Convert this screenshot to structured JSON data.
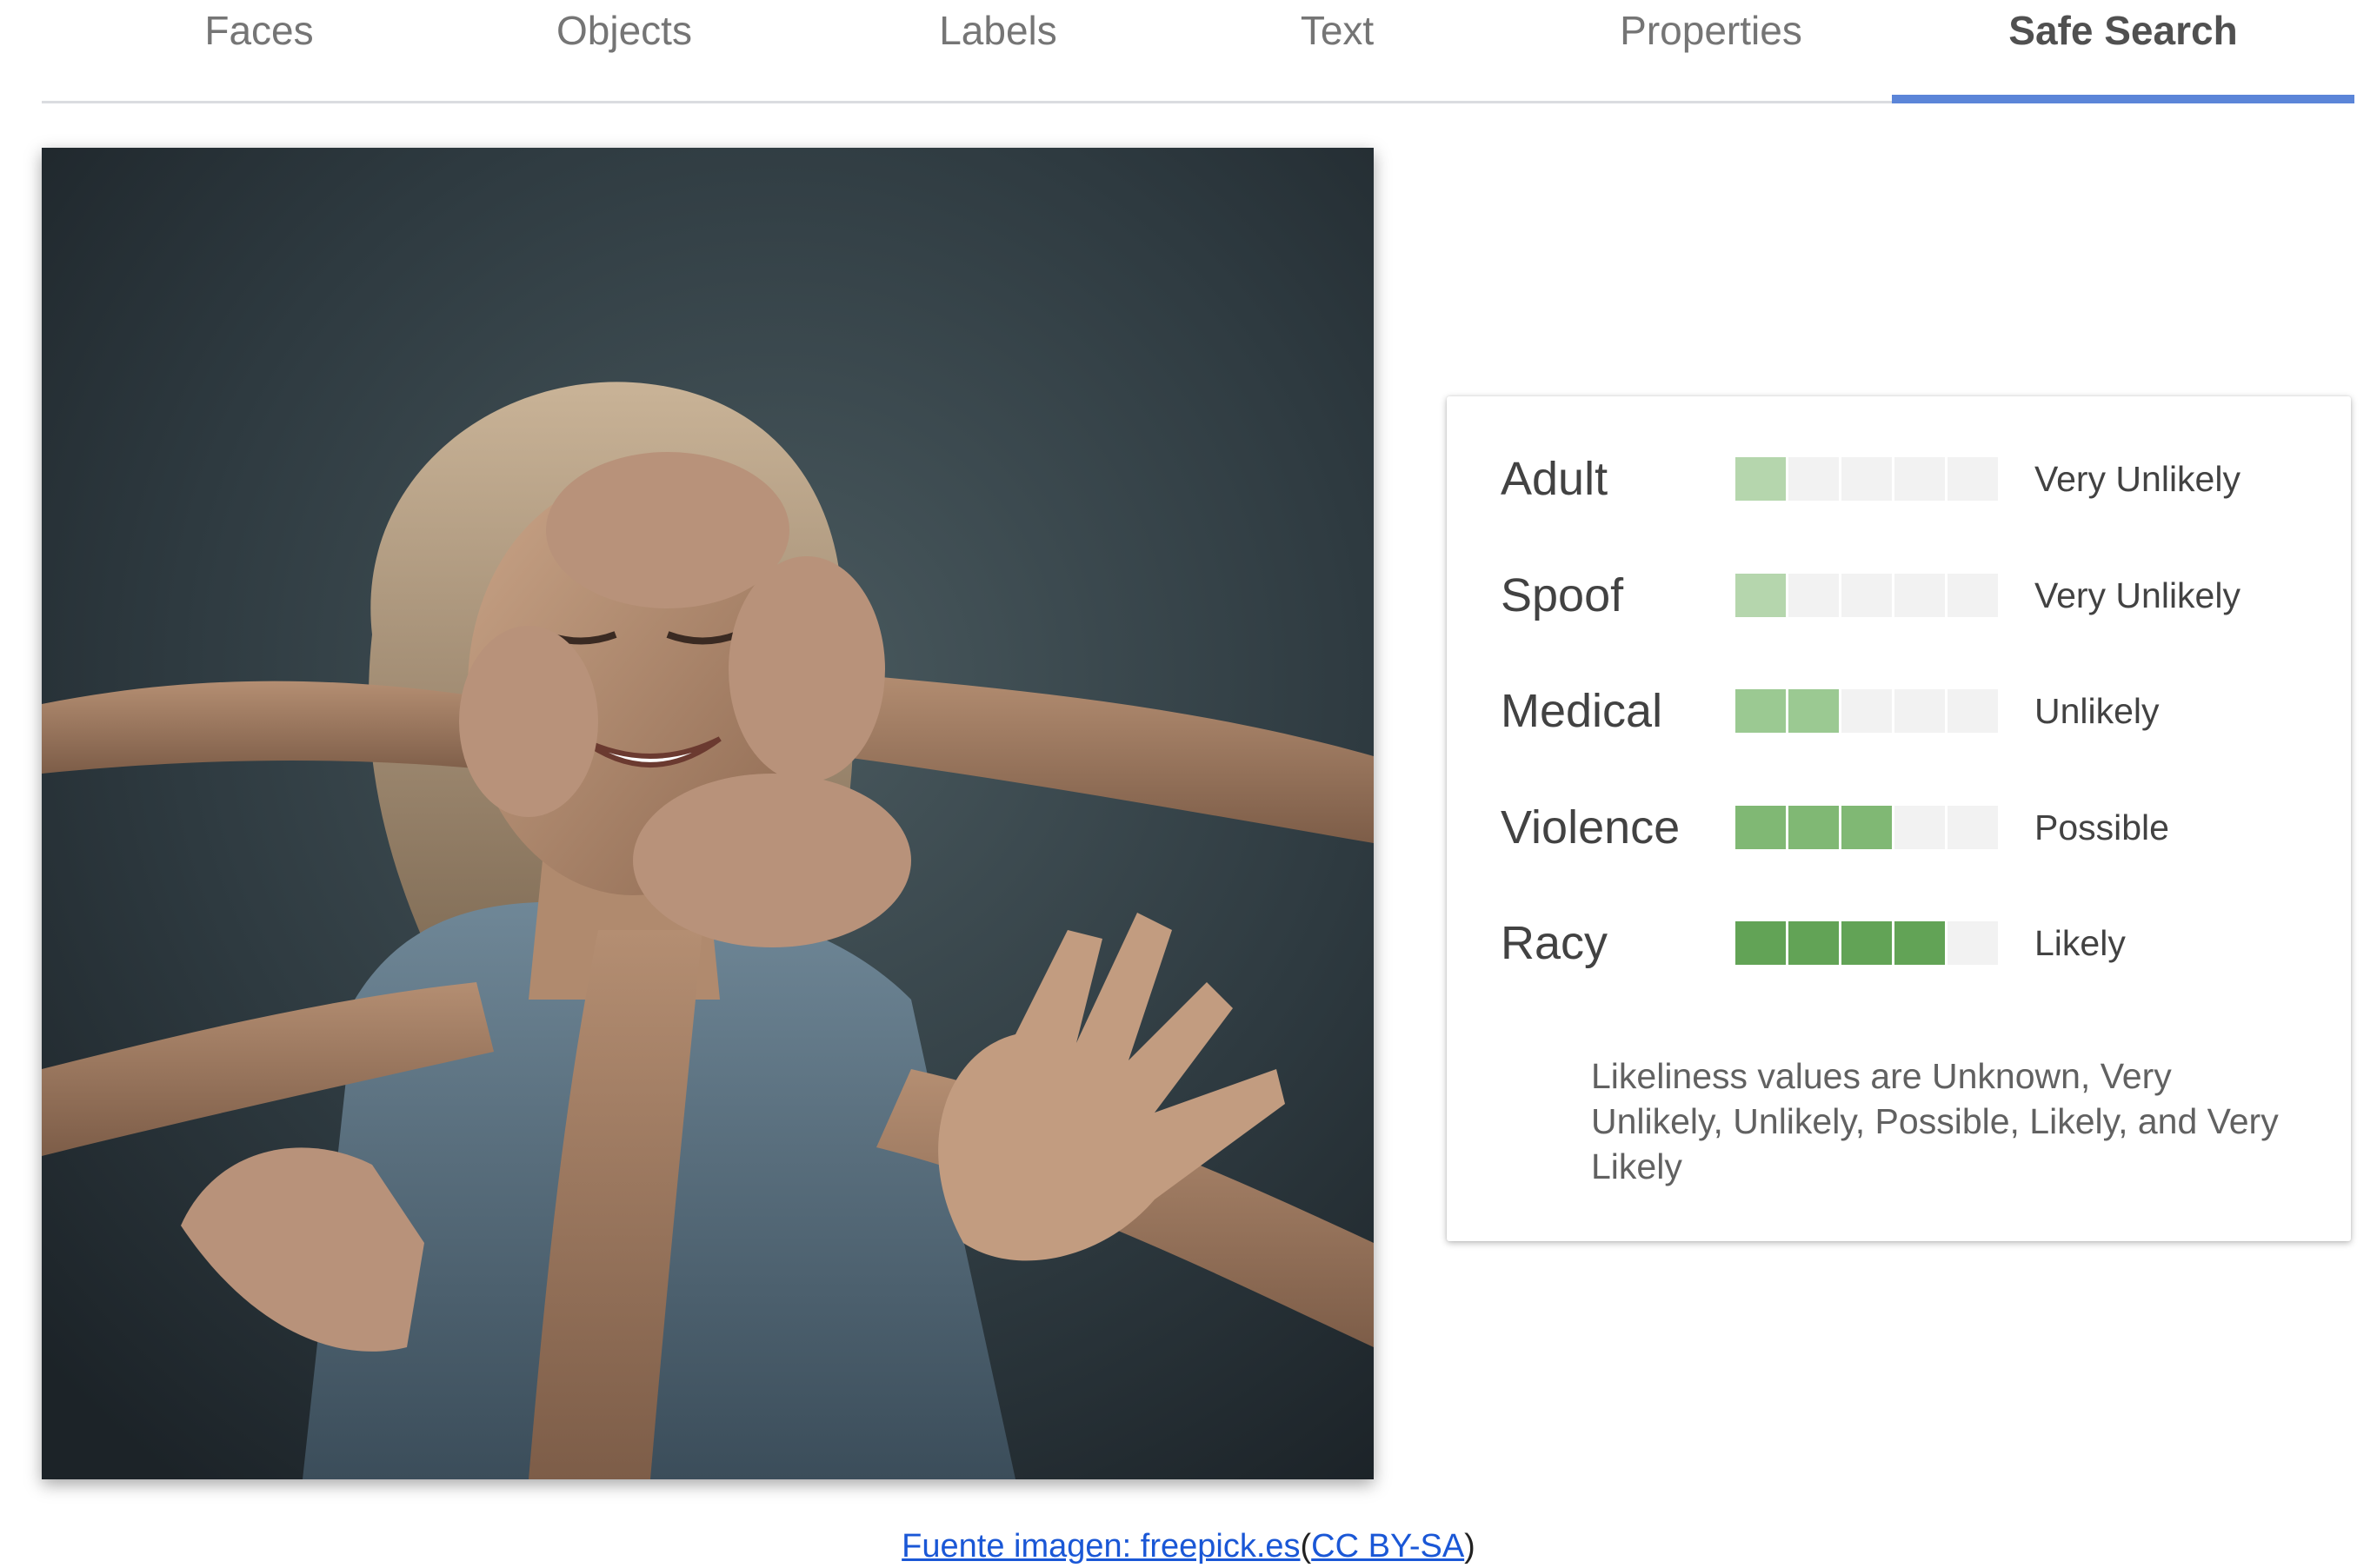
{
  "tabs": [
    {
      "label": "Faces",
      "active": false
    },
    {
      "label": "Objects",
      "active": false
    },
    {
      "label": "Labels",
      "active": false
    },
    {
      "label": "Text",
      "active": false
    },
    {
      "label": "Properties",
      "active": false
    },
    {
      "label": "Safe Search",
      "active": true
    }
  ],
  "colors": {
    "tab_indicator": "#5b85d8",
    "meter_empty": "#f2f2f2",
    "meter_level_1": "#b5d6ad",
    "meter_level_2": "#9bc992",
    "meter_level_3": "#80b874",
    "meter_level_4": "#62a356",
    "link": "#1a57d6"
  },
  "safe_search": {
    "segments_total": 5,
    "rows": [
      {
        "label": "Adult",
        "level": 1,
        "value": "Very Unlikely"
      },
      {
        "label": "Spoof",
        "level": 1,
        "value": "Very Unlikely"
      },
      {
        "label": "Medical",
        "level": 2,
        "value": "Unlikely"
      },
      {
        "label": "Violence",
        "level": 3,
        "value": "Possible"
      },
      {
        "label": "Racy",
        "level": 4,
        "value": "Likely"
      }
    ],
    "note": "Likeliness values are Unknown, Very Unlikely, Unlikely, Possible, Likely, and Very Likely"
  },
  "caption": {
    "link1": "Fuente imagen: freepick.es",
    "open_paren": "(",
    "link2": "CC BY-SA",
    "close_paren": ")"
  }
}
